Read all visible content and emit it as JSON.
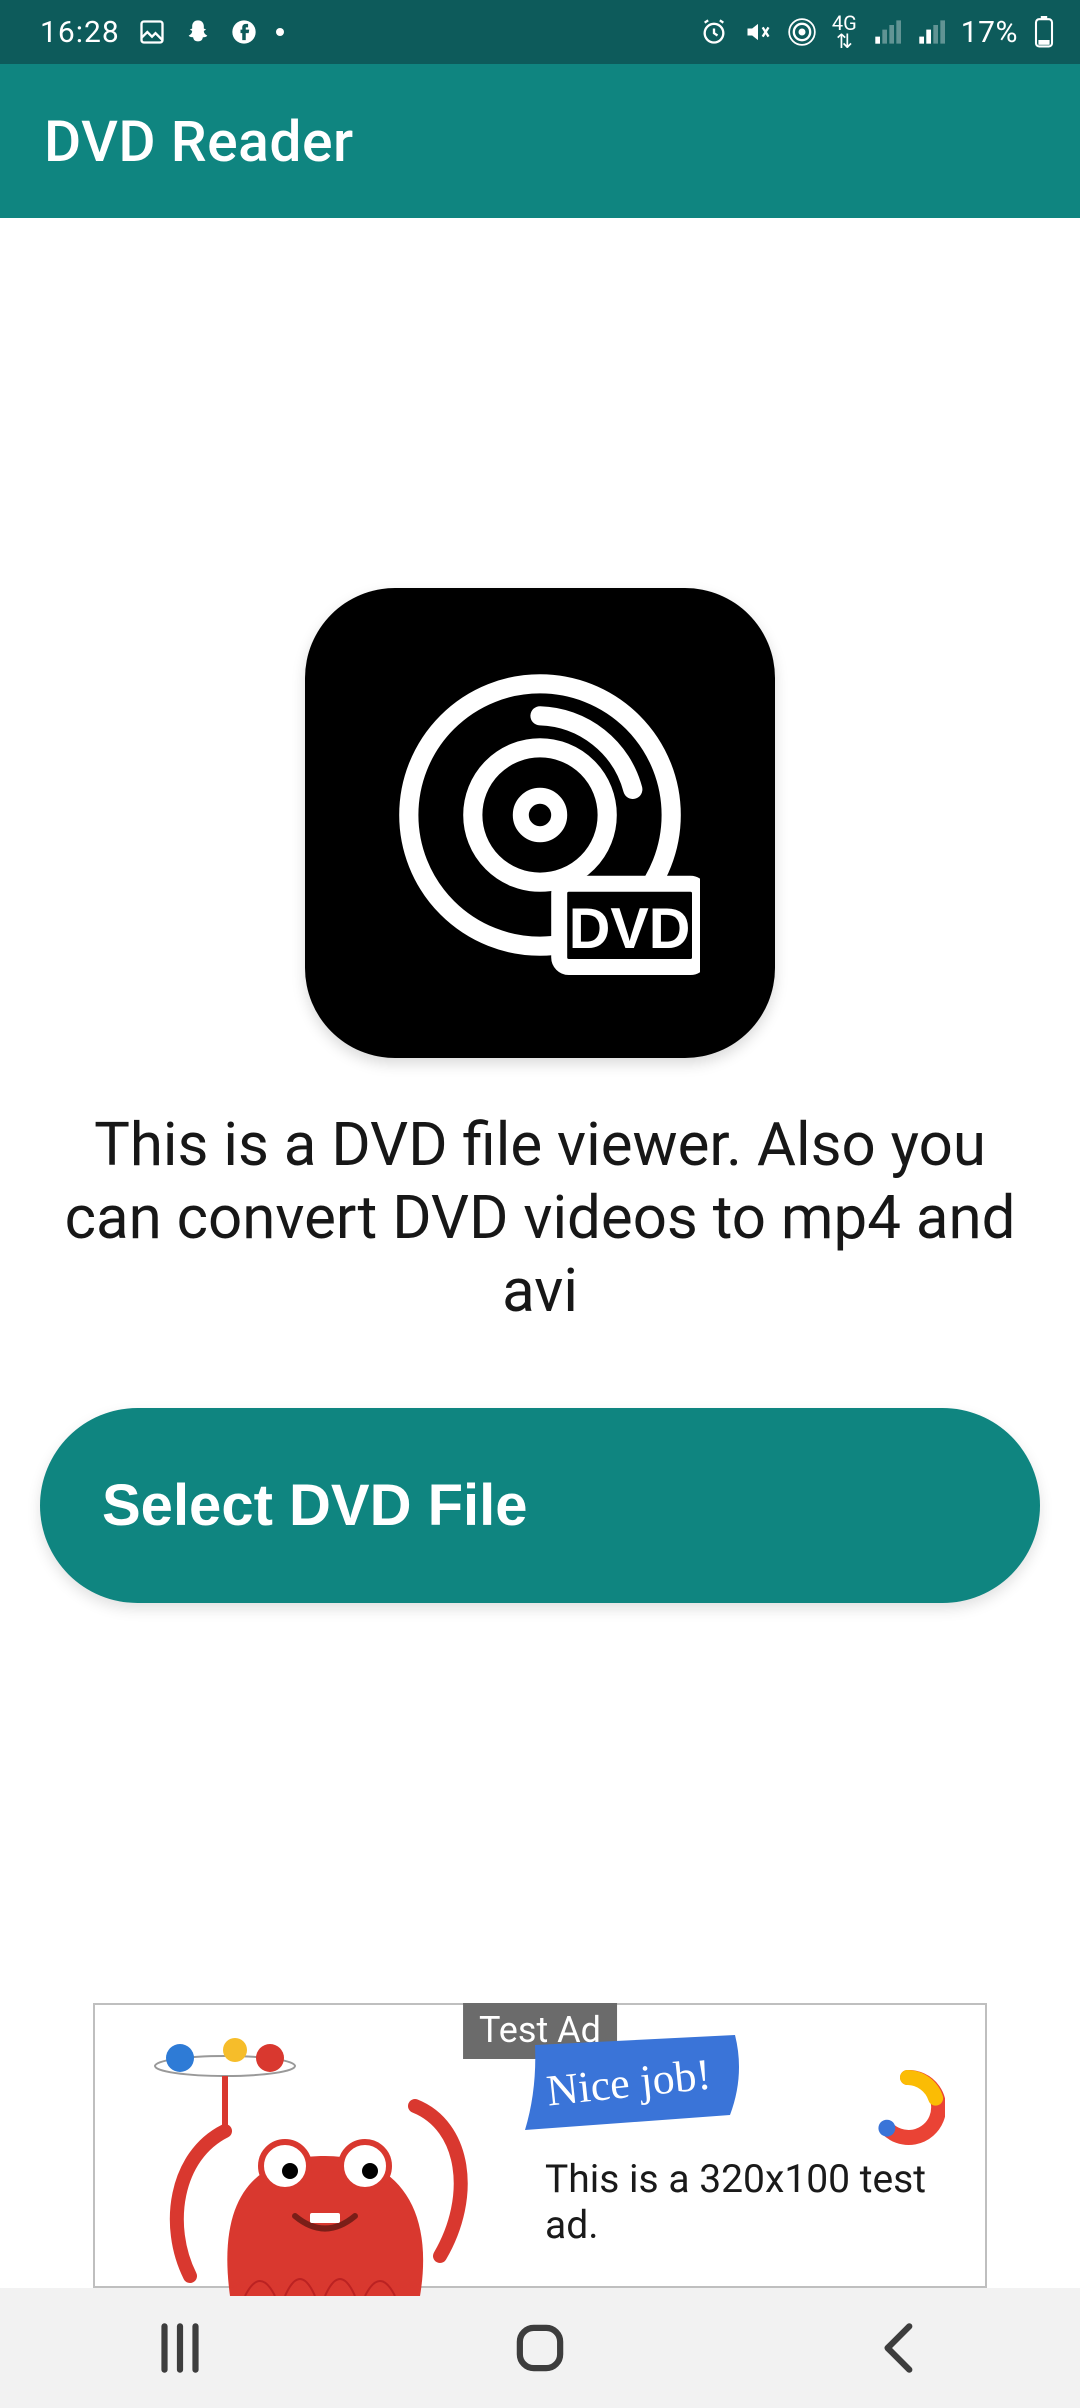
{
  "status_bar": {
    "time": "16:28",
    "battery": "17%",
    "network_label": "4G"
  },
  "app_bar": {
    "title": "DVD Reader"
  },
  "main": {
    "logo_badge": "DVD",
    "description": "This is a DVD file viewer. Also you can convert DVD videos to mp4 and avi",
    "select_button": "Select DVD File"
  },
  "ad": {
    "badge": "Test Ad",
    "flag_text": "Nice job!",
    "message": "This is a 320x100 test ad."
  },
  "colors": {
    "status_bg": "#0d5b5b",
    "app_bar_bg": "#0f8580",
    "button_bg": "#0f8580",
    "nav_bg": "#f2f2f2"
  }
}
